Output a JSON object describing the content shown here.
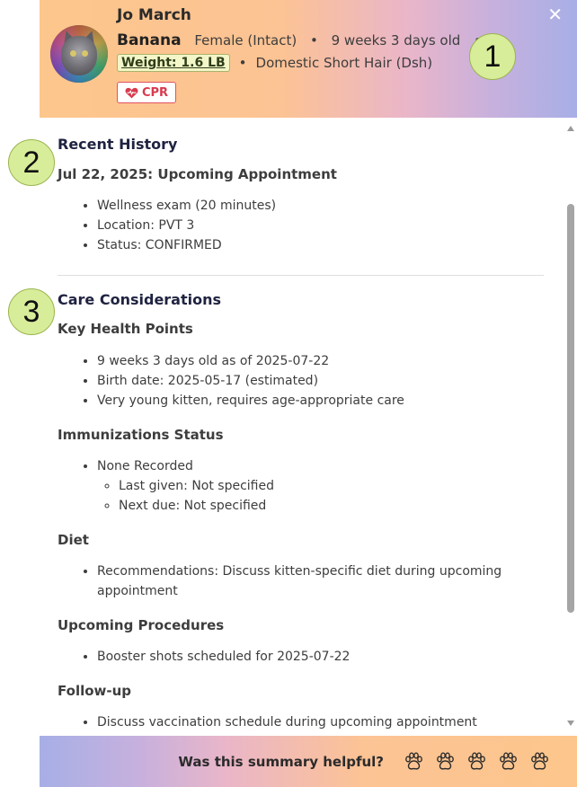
{
  "header": {
    "owner_name": "Jo March",
    "pet_name": "Banana",
    "sex": "Female (Intact)",
    "age": "9 weeks 3 days old",
    "weight": "Weight: 1.6 LB",
    "breed": "Domestic Short Hair (Dsh)",
    "cpr_label": "CPR",
    "close_label": "✕",
    "separator": "•"
  },
  "callouts": [
    "1",
    "2",
    "3"
  ],
  "recent_history": {
    "title": "Recent History",
    "appointment_title": "Jul 22, 2025: Upcoming Appointment",
    "items": [
      "Wellness exam (20 minutes)",
      "Location: PVT 3",
      "Status: CONFIRMED"
    ]
  },
  "care": {
    "title": "Care Considerations",
    "key_health": {
      "title": "Key Health Points",
      "items": [
        "9 weeks 3 days old as of 2025-07-22",
        "Birth date: 2025-05-17 (estimated)",
        "Very young kitten, requires age-appropriate care"
      ]
    },
    "immunizations": {
      "title": "Immunizations Status",
      "item": "None Recorded",
      "sub_items": [
        "Last given: Not specified",
        "Next due: Not specified"
      ]
    },
    "diet": {
      "title": "Diet",
      "items": [
        "Recommendations: Discuss kitten-specific diet during upcoming appointment"
      ]
    },
    "procedures": {
      "title": "Upcoming Procedures",
      "items": [
        "Booster shots scheduled for 2025-07-22"
      ]
    },
    "follow_up": {
      "title": "Follow-up",
      "items": [
        "Discuss vaccination schedule during upcoming appointment"
      ]
    }
  },
  "footer": {
    "question": "Was this summary helpful?",
    "rating_icons": [
      "paw-icon",
      "paw-icon",
      "paw-icon",
      "paw-icon",
      "paw-icon"
    ]
  },
  "colors": {
    "header_gradient_start": "#fdc68c",
    "header_gradient_end": "#a7afe6",
    "cpr_red": "#d83a4d",
    "callout_green": "#d8ed9a"
  }
}
